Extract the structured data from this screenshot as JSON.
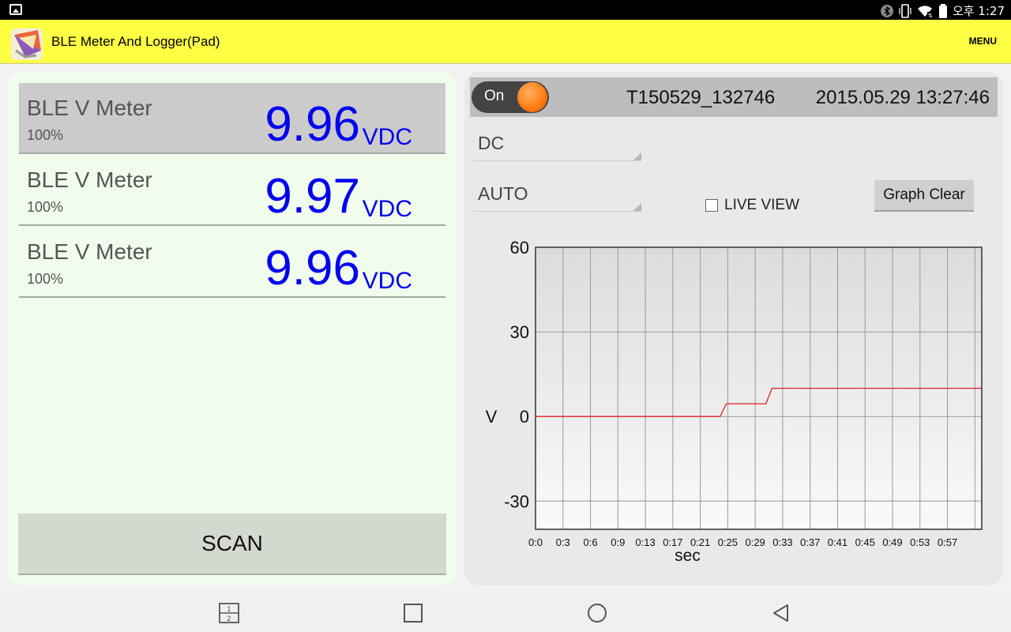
{
  "status_bar": {
    "time": "오후 1:27",
    "icons": [
      "gallery-icon",
      "bluetooth-icon",
      "vibrate-icon",
      "wifi-icon",
      "battery-icon"
    ]
  },
  "app_bar": {
    "title": "BLE Meter And Logger(Pad)",
    "menu_label": "MENU",
    "background": "#ffff44"
  },
  "devices": [
    {
      "name": "BLE V Meter",
      "battery": "100%",
      "value": "9.96",
      "unit": "VDC",
      "selected": true
    },
    {
      "name": "BLE V Meter",
      "battery": "100%",
      "value": "9.97",
      "unit": "VDC",
      "selected": false
    },
    {
      "name": "BLE V Meter",
      "battery": "100%",
      "value": "9.96",
      "unit": "VDC",
      "selected": false
    }
  ],
  "scan_label": "SCAN",
  "logger": {
    "toggle_label": "On",
    "toggle_on": true,
    "session_id": "T150529_132746",
    "datetime": "2015.05.29 13:27:46",
    "mode": "DC",
    "range": "AUTO",
    "live_view_label": "LIVE VIEW",
    "live_view_checked": false,
    "graph_clear_label": "Graph Clear"
  },
  "chart_data": {
    "type": "line",
    "xlabel": "sec",
    "ylabel": "V",
    "ylim": [
      -40,
      60
    ],
    "yticks": [
      60,
      30,
      0,
      -30
    ],
    "xtick_labels": [
      "0:0",
      "0:3",
      "0:6",
      "0:9",
      "0:13",
      "0:17",
      "0:21",
      "0:25",
      "0:29",
      "0:33",
      "0:37",
      "0:41",
      "0:45",
      "0:49",
      "0:53",
      "0:57"
    ],
    "xlim": [
      0,
      58.5
    ],
    "grid": true,
    "line_color": "#e02020",
    "series": [
      {
        "x": [
          0,
          24.2,
          25,
          30.2,
          31,
          58.5
        ],
        "y": [
          0,
          0,
          4.5,
          4.5,
          10,
          10
        ]
      }
    ]
  },
  "nav_bar": {
    "buttons": [
      "dual-window-icon",
      "recents-icon",
      "home-icon",
      "back-icon"
    ]
  }
}
